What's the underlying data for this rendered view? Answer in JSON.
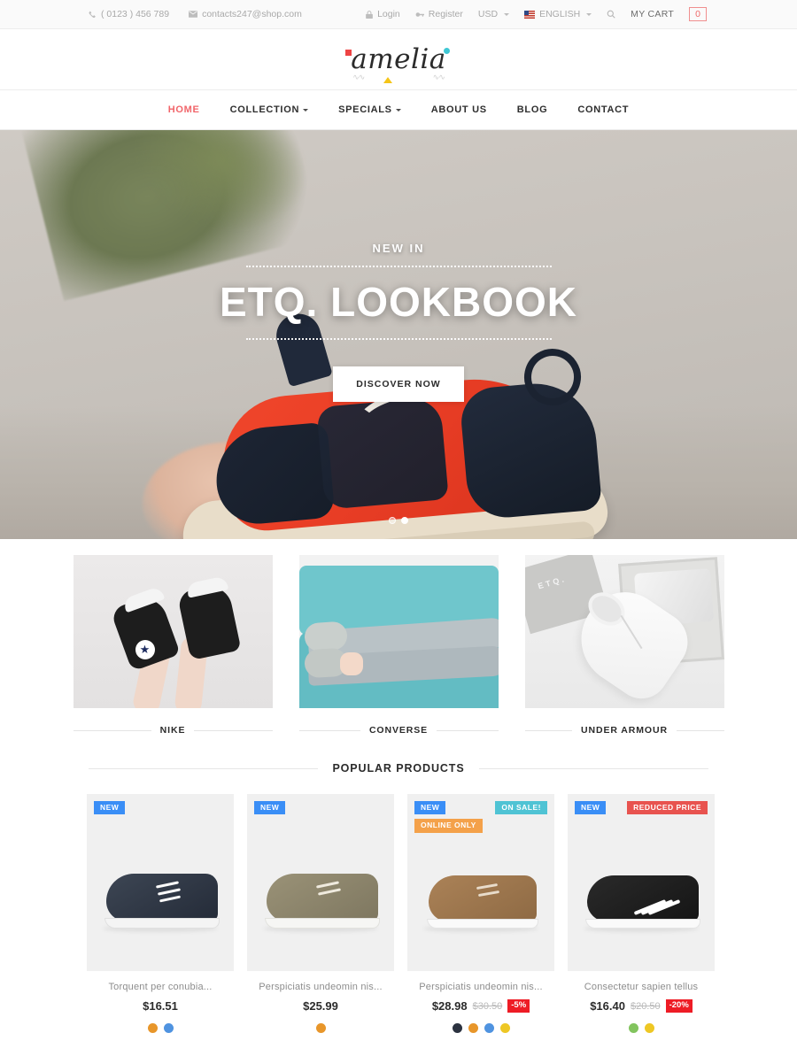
{
  "topbar": {
    "phone": "( 0123 ) 456 789",
    "email": "contacts247@shop.com",
    "login": "Login",
    "register": "Register",
    "currency": "USD",
    "language": "ENGLISH",
    "cart_label": "MY CART",
    "cart_count": "0"
  },
  "brand": {
    "name": "amelia"
  },
  "nav": [
    {
      "label": "HOME",
      "active": true,
      "caret": false
    },
    {
      "label": "COLLECTION",
      "active": false,
      "caret": true
    },
    {
      "label": "SPECIALS",
      "active": false,
      "caret": true
    },
    {
      "label": "ABOUT US",
      "active": false,
      "caret": false
    },
    {
      "label": "BLOG",
      "active": false,
      "caret": false
    },
    {
      "label": "CONTACT",
      "active": false,
      "caret": false
    }
  ],
  "hero": {
    "eyebrow": "NEW IN",
    "title": "ETQ. LOOKBOOK",
    "cta": "DISCOVER NOW",
    "slides": 2,
    "active_slide": 2
  },
  "categories": [
    {
      "label": "NIKE"
    },
    {
      "label": "CONVERSE"
    },
    {
      "label": "UNDER ARMOUR"
    }
  ],
  "popular": {
    "heading": "POPULAR PRODUCTS",
    "items": [
      {
        "name": "Torquent per conubia...",
        "price": "$16.51",
        "old_price": "",
        "discount": "",
        "badges_left": [
          "NEW"
        ],
        "badges_right": [],
        "colors": [
          "#e8962a",
          "#4f93e0"
        ]
      },
      {
        "name": "Perspiciatis undeomin nis...",
        "price": "$25.99",
        "old_price": "",
        "discount": "",
        "badges_left": [
          "NEW"
        ],
        "badges_right": [],
        "colors": [
          "#e8962a"
        ]
      },
      {
        "name": "Perspiciatis undeomin nis...",
        "price": "$28.98",
        "old_price": "$30.50",
        "discount": "-5%",
        "badges_left": [
          "NEW",
          "ONLINE ONLY"
        ],
        "badges_right": [
          "ON SALE!"
        ],
        "colors": [
          "#2b3240",
          "#e8962a",
          "#4f93e0",
          "#eec724"
        ]
      },
      {
        "name": "Consectetur sapien tellus",
        "price": "$16.40",
        "old_price": "$20.50",
        "discount": "-20%",
        "badges_left": [
          "NEW"
        ],
        "badges_right": [
          "REDUCED PRICE"
        ],
        "colors": [
          "#82c45e",
          "#eec724"
        ]
      }
    ]
  },
  "colors": {
    "accent": "#f1656a",
    "badge_new": "#3a8ef6",
    "badge_online": "#f4a14a",
    "badge_sale": "#4fc3d4",
    "badge_reduced": "#e8534f",
    "discount": "#ee1c25"
  }
}
